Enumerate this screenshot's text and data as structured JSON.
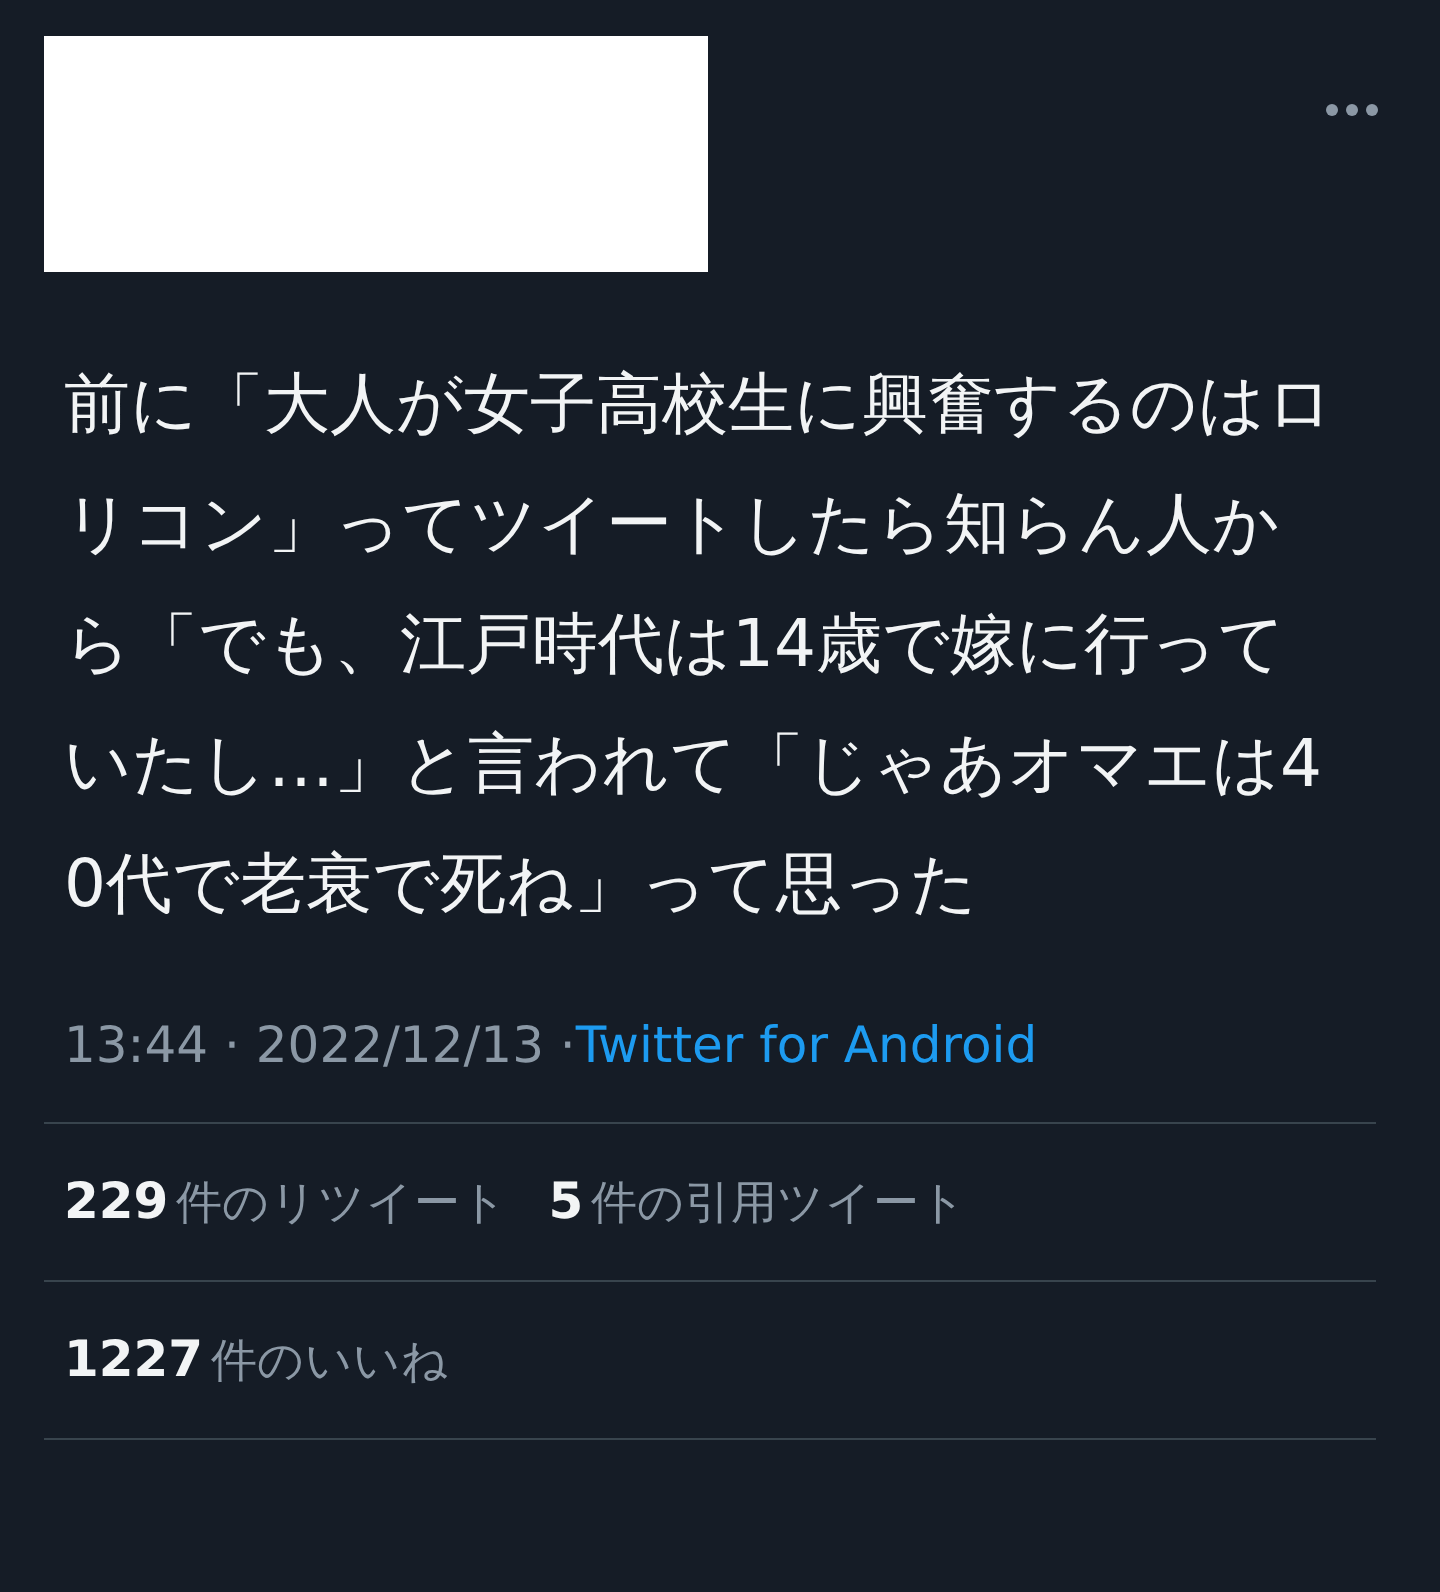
{
  "tweet": {
    "text": "前に「大人が女子高校生に興奮するのはロリコン」ってツイートしたら知らん人から「でも、江戸時代は14歳で嫁に行っていたし…」と言われて「じゃあオマエは40代で老衰で死ね」って思った",
    "time": "13:44 · 2022/12/13 · ",
    "client": "Twitter for Android"
  },
  "stats": [
    {
      "items": [
        {
          "count": "229",
          "label": "件のリツイート"
        },
        {
          "count": "5",
          "label": "件の引用ツイート"
        }
      ]
    },
    {
      "items": [
        {
          "count": "1227",
          "label": "件のいいね"
        }
      ]
    }
  ]
}
